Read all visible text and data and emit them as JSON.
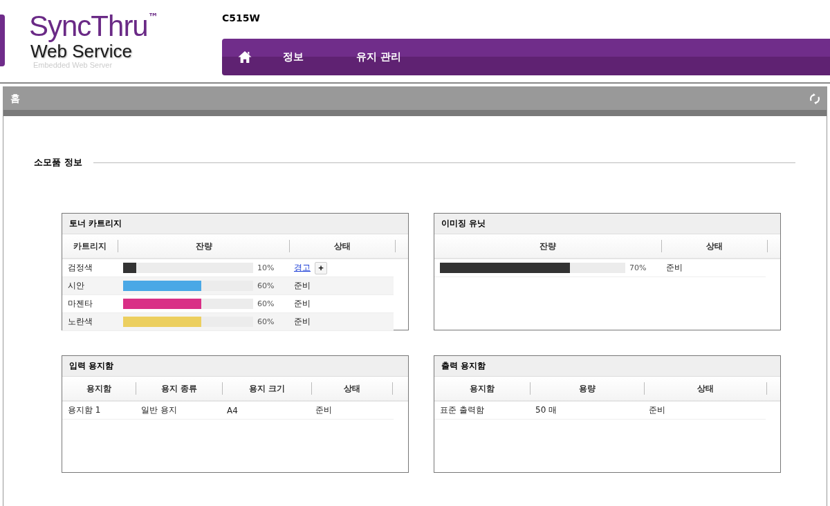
{
  "header": {
    "logo_title": "SyncThru",
    "logo_mark": "™",
    "logo_subtitle": "Web Service",
    "logo_caption": "Embedded Web Server",
    "model": "C515W"
  },
  "nav": {
    "items": [
      {
        "kind": "home"
      },
      {
        "kind": "text",
        "label": "정보"
      },
      {
        "kind": "text",
        "label": "유지 관리"
      }
    ]
  },
  "page": {
    "title": "홈",
    "section_title": "소모품 정보",
    "panels": [
      {
        "title": "토너 카트리지",
        "columns": [
          {
            "label": "카트리지"
          },
          {
            "label": "잔량"
          },
          {
            "label": "상태"
          }
        ],
        "rows": [
          [
            {
              "kind": "text",
              "text": "검정색"
            },
            {
              "kind": "level",
              "level": 0.1,
              "reading": "10%",
              "color": "#333333"
            },
            {
              "kind": "link",
              "text": "경고",
              "action": "+"
            }
          ],
          [
            {
              "kind": "text",
              "text": "시안"
            },
            {
              "kind": "level",
              "level": 0.6,
              "reading": "60%",
              "color": "#4aa8e6"
            },
            {
              "kind": "text",
              "text": "준비"
            }
          ],
          [
            {
              "kind": "text",
              "text": "마젠타"
            },
            {
              "kind": "level",
              "level": 0.6,
              "reading": "60%",
              "color": "#d92f86"
            },
            {
              "kind": "text",
              "text": "준비"
            }
          ],
          [
            {
              "kind": "text",
              "text": "노란색"
            },
            {
              "kind": "level",
              "level": 0.6,
              "reading": "60%",
              "color": "#eccf5f"
            },
            {
              "kind": "text",
              "text": "준비"
            }
          ]
        ]
      },
      {
        "title": "이미징 유닛",
        "columns": [
          {
            "label": "잔량"
          },
          {
            "label": "상태"
          }
        ],
        "rows": [
          [
            {
              "kind": "level",
              "level": 0.7,
              "reading": "70%",
              "color": "#333333"
            },
            {
              "kind": "text",
              "text": "준비"
            }
          ]
        ]
      },
      {
        "title": "입력 용지함",
        "columns": [
          {
            "label": "용지함"
          },
          {
            "label": "용지 종류"
          },
          {
            "label": "용지 크기"
          },
          {
            "label": "상태"
          }
        ],
        "rows": [
          [
            {
              "kind": "text",
              "text": "용지함 1"
            },
            {
              "kind": "text",
              "text": "일반 용지"
            },
            {
              "kind": "text",
              "text": "A4"
            },
            {
              "kind": "text",
              "text": "준비"
            }
          ]
        ]
      },
      {
        "title": "출력 용지함",
        "columns": [
          {
            "label": "용지함"
          },
          {
            "label": "용량"
          },
          {
            "label": "상태"
          }
        ],
        "rows": [
          [
            {
              "kind": "text",
              "text": "표준 출력함"
            },
            {
              "kind": "text",
              "text": "50 매"
            },
            {
              "kind": "text",
              "text": "준비"
            }
          ]
        ]
      }
    ]
  }
}
